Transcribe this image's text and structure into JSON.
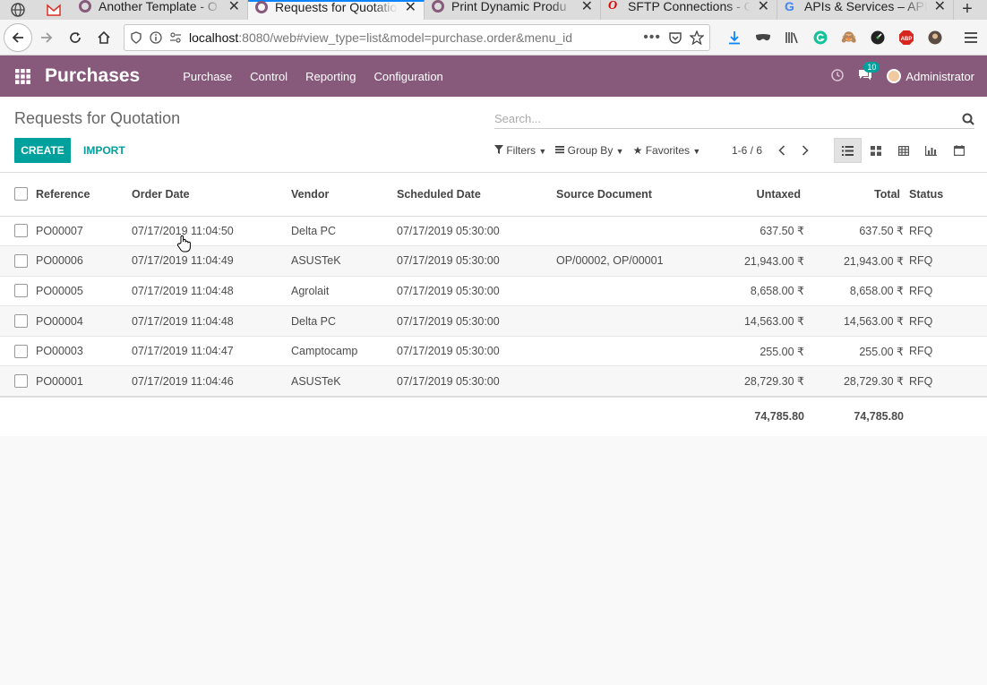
{
  "browser": {
    "tabs": [
      {
        "title": "Another Template - O",
        "active": false
      },
      {
        "title": "Requests for Quotatio",
        "active": true
      },
      {
        "title": "Print Dynamic Produ",
        "active": false
      },
      {
        "title": "SFTP Connections - O",
        "active": false
      },
      {
        "title": "APIs & Services – API",
        "active": false
      }
    ],
    "url_host": "localhost",
    "url_rest": ":8080/web#view_type=list&model=purchase.order&menu_id"
  },
  "header": {
    "app_title": "Purchases",
    "menu": [
      "Purchase",
      "Control",
      "Reporting",
      "Configuration"
    ],
    "message_count": "10",
    "user": "Administrator"
  },
  "control_panel": {
    "title": "Requests for Quotation",
    "search_placeholder": "Search...",
    "create_label": "CREATE",
    "import_label": "IMPORT",
    "filters_label": "Filters",
    "groupby_label": "Group By",
    "favorites_label": "Favorites",
    "pager": "1-6 / 6"
  },
  "table": {
    "columns": [
      "Reference",
      "Order Date",
      "Vendor",
      "Scheduled Date",
      "Source Document",
      "Untaxed",
      "Total",
      "Status"
    ],
    "rows": [
      {
        "ref": "PO00007",
        "order_date": "07/17/2019 11:04:50",
        "vendor": "Delta PC",
        "scheduled": "07/17/2019 05:30:00",
        "source": "",
        "untaxed": "637.50 ₹",
        "total": "637.50 ₹",
        "status": "RFQ"
      },
      {
        "ref": "PO00006",
        "order_date": "07/17/2019 11:04:49",
        "vendor": "ASUSTeK",
        "scheduled": "07/17/2019 05:30:00",
        "source": "OP/00002, OP/00001",
        "untaxed": "21,943.00 ₹",
        "total": "21,943.00 ₹",
        "status": "RFQ"
      },
      {
        "ref": "PO00005",
        "order_date": "07/17/2019 11:04:48",
        "vendor": "Agrolait",
        "scheduled": "07/17/2019 05:30:00",
        "source": "",
        "untaxed": "8,658.00 ₹",
        "total": "8,658.00 ₹",
        "status": "RFQ"
      },
      {
        "ref": "PO00004",
        "order_date": "07/17/2019 11:04:48",
        "vendor": "Delta PC",
        "scheduled": "07/17/2019 05:30:00",
        "source": "",
        "untaxed": "14,563.00 ₹",
        "total": "14,563.00 ₹",
        "status": "RFQ"
      },
      {
        "ref": "PO00003",
        "order_date": "07/17/2019 11:04:47",
        "vendor": "Camptocamp",
        "scheduled": "07/17/2019 05:30:00",
        "source": "",
        "untaxed": "255.00 ₹",
        "total": "255.00 ₹",
        "status": "RFQ"
      },
      {
        "ref": "PO00001",
        "order_date": "07/17/2019 11:04:46",
        "vendor": "ASUSTeK",
        "scheduled": "07/17/2019 05:30:00",
        "source": "",
        "untaxed": "28,729.30 ₹",
        "total": "28,729.30 ₹",
        "status": "RFQ"
      }
    ],
    "totals": {
      "untaxed": "74,785.80",
      "total": "74,785.80"
    }
  },
  "colors": {
    "brand": "#875a7b",
    "accent": "#00a09d"
  }
}
